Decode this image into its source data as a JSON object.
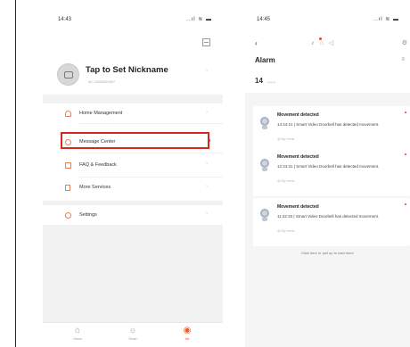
{
  "phone1": {
    "status_time": "14:43",
    "status_sys": "..ıl ≋ ▬",
    "profile": {
      "nickname": "Tap to Set Nickname",
      "account": "86-13856855897"
    },
    "menu_group1": [
      {
        "label": "Home Management",
        "icon": "home-icon"
      },
      {
        "label": "Message Center",
        "icon": "message-icon"
      },
      {
        "label": "FAQ & Feedback",
        "icon": "faq-icon"
      },
      {
        "label": "More Services",
        "icon": "services-icon"
      }
    ],
    "menu_group2": [
      {
        "label": "Settings",
        "icon": "settings-icon"
      }
    ],
    "tabs": [
      {
        "label": "Home",
        "icon": "home-tab-icon",
        "glyph": "⌂"
      },
      {
        "label": "Smart",
        "icon": "smart-tab-icon",
        "glyph": "☼"
      },
      {
        "label": "Me",
        "icon": "me-tab-icon",
        "glyph": "◉"
      }
    ],
    "accent_color": "#f05a28",
    "highlight_color": "#d22a20"
  },
  "phone2": {
    "status_time": "14:45",
    "status_sys": "..ıl ≋ ▬",
    "header_glyphs": {
      "back": "‹",
      "bell": "♪",
      "home": "⌂",
      "speaker": "◁",
      "gear": "⚙",
      "filter": "≡"
    },
    "title": "Alarm",
    "date": {
      "day": "14",
      "month": "August"
    },
    "alerts": [
      {
        "title": "Movement detected",
        "text": "14:44:21 | Smart Video Doorbell has detected movement.",
        "home": "@ My Home"
      },
      {
        "title": "Movement detected",
        "text": "12:44:31 | Smart Video Doorbell has detected movement.",
        "home": "@ My Home"
      },
      {
        "title": "Movement detected",
        "text": "11:42:33 | Smart Video Doorbell has detected movement.",
        "home": "@ My Home"
      }
    ],
    "load_more": "Click here or pull up to load more"
  }
}
